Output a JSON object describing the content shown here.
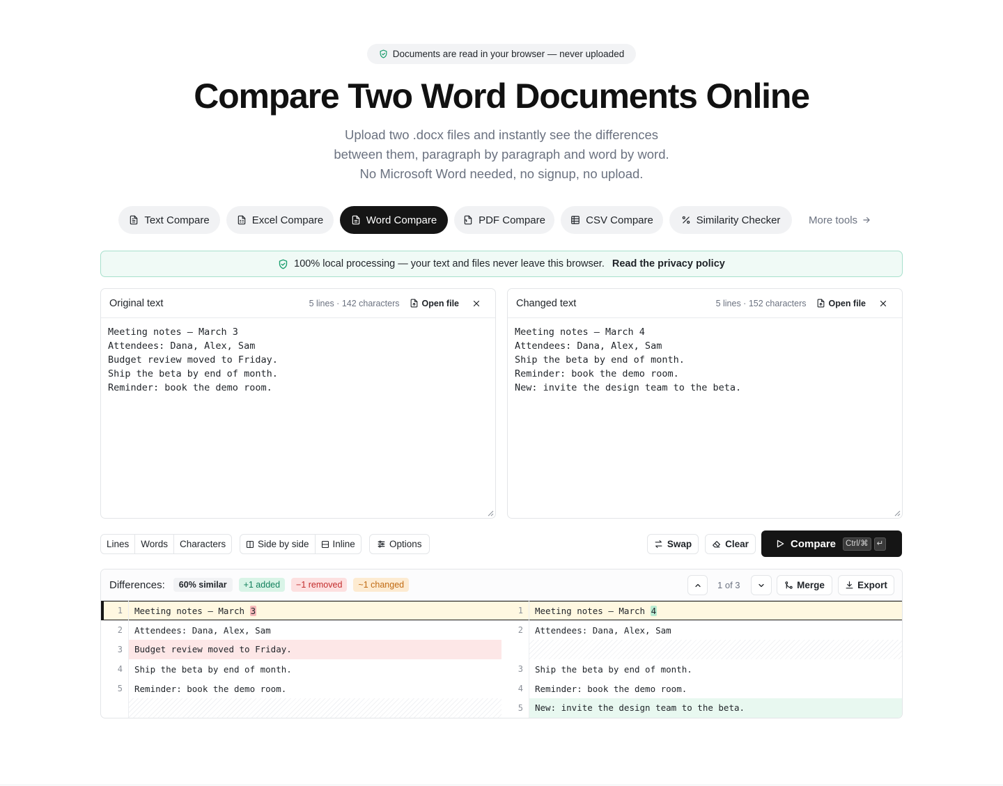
{
  "badge": {
    "text": "Documents are read in your browser — never uploaded",
    "icon": "shield-check-icon"
  },
  "title": "Compare Two Word Documents Online",
  "subtitle": "Upload two .docx files and instantly see the differences between them, paragraph by paragraph and word by word. No Microsoft Word needed, no signup, no upload.",
  "tabs": [
    {
      "label": "Text Compare",
      "icon": "file-text-icon",
      "active": false
    },
    {
      "label": "Excel Compare",
      "icon": "spreadsheet-file-icon",
      "active": false
    },
    {
      "label": "Word Compare",
      "icon": "document-icon",
      "active": true
    },
    {
      "label": "PDF Compare",
      "icon": "pdf-file-icon",
      "active": false
    },
    {
      "label": "CSV Compare",
      "icon": "table-icon",
      "active": false
    },
    {
      "label": "Similarity Checker",
      "icon": "percent-icon",
      "active": false
    }
  ],
  "more_tools": "More tools",
  "privacy": {
    "text": "100% local processing — your text and files never leave this browser.",
    "link": "Read the privacy policy"
  },
  "original": {
    "title": "Original text",
    "stats": "5 lines · 142 characters",
    "open_file": "Open file",
    "content": "Meeting notes — March 3\nAttendees: Dana, Alex, Sam\nBudget review moved to Friday.\nShip the beta by end of month.\nReminder: book the demo room."
  },
  "changed": {
    "title": "Changed text",
    "stats": "5 lines · 152 characters",
    "open_file": "Open file",
    "content": "Meeting notes — March 4\nAttendees: Dana, Alex, Sam\nShip the beta by end of month.\nReminder: book the demo room.\nNew: invite the design team to the beta."
  },
  "toolbar": {
    "granularity": [
      "Lines",
      "Words",
      "Characters"
    ],
    "view_side": "Side by side",
    "view_inline": "Inline",
    "options": "Options",
    "swap": "Swap",
    "clear": "Clear",
    "compare": "Compare",
    "shortcut_mod": "Ctrl/⌘",
    "shortcut_key": "↵"
  },
  "diff": {
    "label": "Differences:",
    "similar": "60% similar",
    "added": "+1 added",
    "removed": "−1 removed",
    "changed": "~1 changed",
    "nav_count": "1 of 3",
    "merge": "Merge",
    "export": "Export",
    "rows": [
      {
        "left_no": "1",
        "left_pre": "Meeting notes — March ",
        "left_hl": "3",
        "right_no": "1",
        "right_pre": "Meeting notes — March ",
        "right_hl": "4",
        "type": "changed"
      },
      {
        "left_no": "2",
        "left_pre": "Attendees: Dana, Alex, Sam",
        "left_hl": "",
        "right_no": "2",
        "right_pre": "Attendees: Dana, Alex, Sam",
        "right_hl": "",
        "type": "same"
      },
      {
        "left_no": "3",
        "left_pre": "Budget review moved to Friday.",
        "left_hl": "",
        "right_no": "",
        "right_pre": "",
        "right_hl": "",
        "type": "removed"
      },
      {
        "left_no": "4",
        "left_pre": "Ship the beta by end of month.",
        "left_hl": "",
        "right_no": "3",
        "right_pre": "Ship the beta by end of month.",
        "right_hl": "",
        "type": "same"
      },
      {
        "left_no": "5",
        "left_pre": "Reminder: book the demo room.",
        "left_hl": "",
        "right_no": "4",
        "right_pre": "Reminder: book the demo room.",
        "right_hl": "",
        "type": "same"
      },
      {
        "left_no": "",
        "left_pre": "",
        "left_hl": "",
        "right_no": "5",
        "right_pre": "New: invite the design team to the beta.",
        "right_hl": "",
        "type": "added"
      }
    ]
  },
  "colors": {
    "accent": "#151515",
    "added_bg": "#e8f8f0",
    "removed_bg": "#fde7e7",
    "changed_bg": "#fff8e1",
    "privacy_border": "#a7e0cc"
  }
}
